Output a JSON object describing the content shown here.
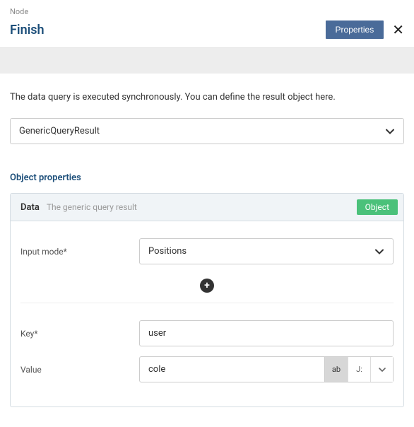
{
  "breadcrumb": "Node",
  "title": "Finish",
  "buttons": {
    "properties": "Properties"
  },
  "description": "The data query is executed synchronously. You can define the result object here.",
  "resultType": {
    "value": "GenericQueryResult"
  },
  "sectionTitle": "Object properties",
  "panel": {
    "title": "Data",
    "subtitle": "The generic query result",
    "badge": "Object"
  },
  "form": {
    "inputMode": {
      "label": "Input mode*",
      "value": "Positions"
    },
    "key": {
      "label": "Key*",
      "value": "user"
    },
    "value": {
      "label": "Value",
      "value": "cole",
      "mode_text": "ab",
      "mode_expr": "J:"
    }
  }
}
